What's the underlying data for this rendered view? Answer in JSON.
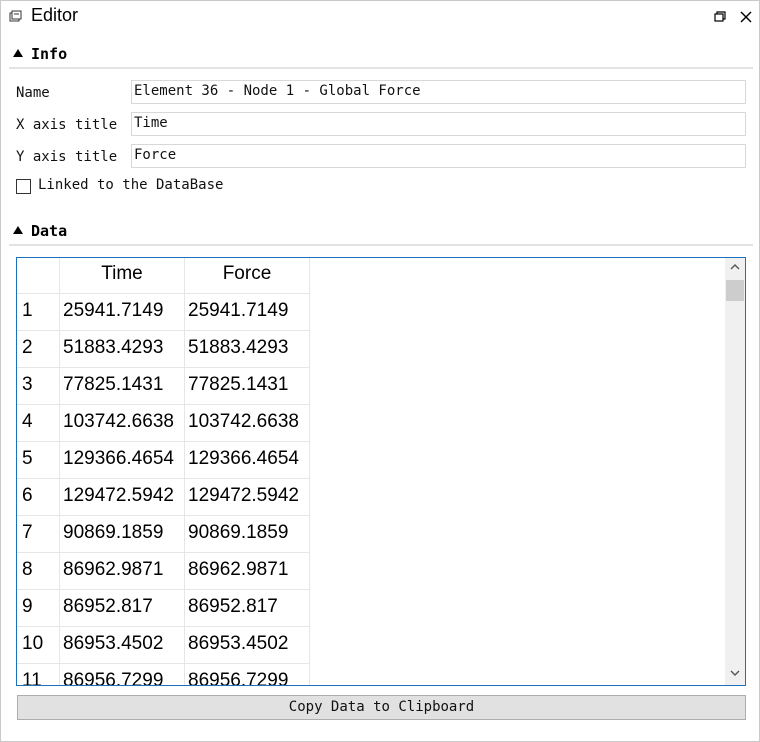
{
  "window": {
    "title": "Editor",
    "icons": {
      "app": "window-icon",
      "restore": "restore-icon",
      "close": "close-icon"
    }
  },
  "info": {
    "section_label": "Info",
    "name_label": "Name",
    "name_value": "Element 36 - Node 1 - Global Force",
    "x_axis_label": "X axis title",
    "x_axis_value": "Time",
    "y_axis_label": "Y axis title",
    "y_axis_value": "Force",
    "linked_label": "Linked to the DataBase",
    "linked_checked": false
  },
  "data": {
    "section_label": "Data",
    "columns": [
      "Time",
      "Force"
    ],
    "rows": [
      {
        "index": "1",
        "time": "25941.7149",
        "force": "25941.7149"
      },
      {
        "index": "2",
        "time": "51883.4293",
        "force": "51883.4293"
      },
      {
        "index": "3",
        "time": "77825.1431",
        "force": "77825.1431"
      },
      {
        "index": "4",
        "time": "103742.6638",
        "force": "103742.6638"
      },
      {
        "index": "5",
        "time": "129366.4654",
        "force": "129366.4654"
      },
      {
        "index": "6",
        "time": "129472.5942",
        "force": "129472.5942"
      },
      {
        "index": "7",
        "time": "90869.1859",
        "force": "90869.1859"
      },
      {
        "index": "8",
        "time": "86962.9871",
        "force": "86962.9871"
      },
      {
        "index": "9",
        "time": "86952.817",
        "force": "86952.817"
      },
      {
        "index": "10",
        "time": "86953.4502",
        "force": "86953.4502"
      },
      {
        "index": "11",
        "time": "86956.7299",
        "force": "86956.7299"
      }
    ]
  },
  "copy_button_label": "Copy Data to Clipboard",
  "colors": {
    "accent": "#1a72bb",
    "button_bg": "#e1e1e1",
    "grid_line": "#e6e6e6"
  }
}
